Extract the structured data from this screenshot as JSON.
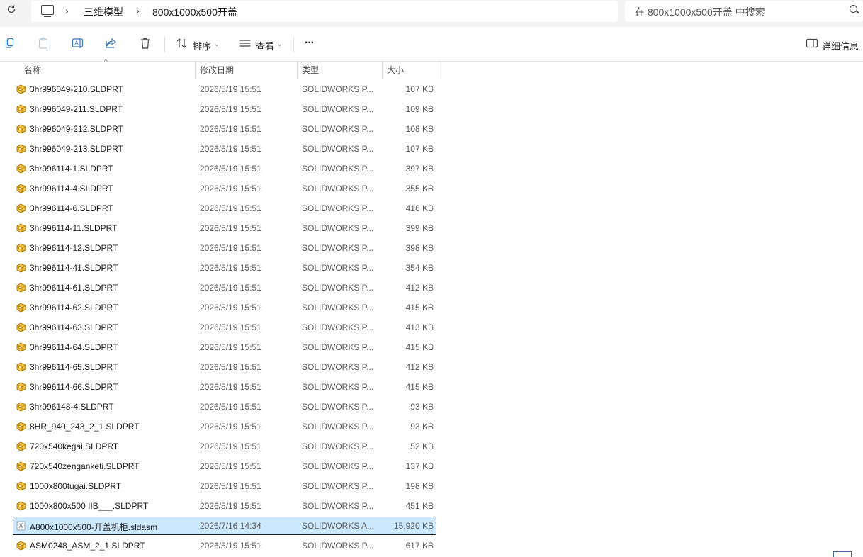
{
  "address": {
    "crumbs": [
      "三维模型",
      "800x1000x500开盖"
    ],
    "search_placeholder": "在 800x1000x500开盖 中搜索",
    "icons": [
      "refresh-icon",
      "this-pc-icon",
      "chevron-right-icon",
      "search-icon"
    ]
  },
  "toolbar": {
    "sort_label": "排序",
    "view_label": "查看",
    "more_label": "···",
    "details_label": "详细信息"
  },
  "columns": {
    "name": "名称",
    "date": "修改日期",
    "type": "类型",
    "size": "大小"
  },
  "files": [
    {
      "name": "3hr996049-210.SLDPRT",
      "date": "2026/5/19 15:51",
      "type": "SOLIDWORKS P...",
      "size": "107 KB",
      "icon": "part"
    },
    {
      "name": "3hr996049-211.SLDPRT",
      "date": "2026/5/19 15:51",
      "type": "SOLIDWORKS P...",
      "size": "109 KB",
      "icon": "part"
    },
    {
      "name": "3hr996049-212.SLDPRT",
      "date": "2026/5/19 15:51",
      "type": "SOLIDWORKS P...",
      "size": "108 KB",
      "icon": "part"
    },
    {
      "name": "3hr996049-213.SLDPRT",
      "date": "2026/5/19 15:51",
      "type": "SOLIDWORKS P...",
      "size": "107 KB",
      "icon": "part"
    },
    {
      "name": "3hr996114-1.SLDPRT",
      "date": "2026/5/19 15:51",
      "type": "SOLIDWORKS P...",
      "size": "397 KB",
      "icon": "part"
    },
    {
      "name": "3hr996114-4.SLDPRT",
      "date": "2026/5/19 15:51",
      "type": "SOLIDWORKS P...",
      "size": "355 KB",
      "icon": "part"
    },
    {
      "name": "3hr996114-6.SLDPRT",
      "date": "2026/5/19 15:51",
      "type": "SOLIDWORKS P...",
      "size": "416 KB",
      "icon": "part"
    },
    {
      "name": "3hr996114-11.SLDPRT",
      "date": "2026/5/19 15:51",
      "type": "SOLIDWORKS P...",
      "size": "399 KB",
      "icon": "part"
    },
    {
      "name": "3hr996114-12.SLDPRT",
      "date": "2026/5/19 15:51",
      "type": "SOLIDWORKS P...",
      "size": "398 KB",
      "icon": "part"
    },
    {
      "name": "3hr996114-41.SLDPRT",
      "date": "2026/5/19 15:51",
      "type": "SOLIDWORKS P...",
      "size": "354 KB",
      "icon": "part"
    },
    {
      "name": "3hr996114-61.SLDPRT",
      "date": "2026/5/19 15:51",
      "type": "SOLIDWORKS P...",
      "size": "412 KB",
      "icon": "part"
    },
    {
      "name": "3hr996114-62.SLDPRT",
      "date": "2026/5/19 15:51",
      "type": "SOLIDWORKS P...",
      "size": "415 KB",
      "icon": "part"
    },
    {
      "name": "3hr996114-63.SLDPRT",
      "date": "2026/5/19 15:51",
      "type": "SOLIDWORKS P...",
      "size": "413 KB",
      "icon": "part"
    },
    {
      "name": "3hr996114-64.SLDPRT",
      "date": "2026/5/19 15:51",
      "type": "SOLIDWORKS P...",
      "size": "415 KB",
      "icon": "part"
    },
    {
      "name": "3hr996114-65.SLDPRT",
      "date": "2026/5/19 15:51",
      "type": "SOLIDWORKS P...",
      "size": "412 KB",
      "icon": "part"
    },
    {
      "name": "3hr996114-66.SLDPRT",
      "date": "2026/5/19 15:51",
      "type": "SOLIDWORKS P...",
      "size": "415 KB",
      "icon": "part"
    },
    {
      "name": "3hr996148-4.SLDPRT",
      "date": "2026/5/19 15:51",
      "type": "SOLIDWORKS P...",
      "size": "93 KB",
      "icon": "part"
    },
    {
      "name": "8HR_940_243_2_1.SLDPRT",
      "date": "2026/5/19 15:51",
      "type": "SOLIDWORKS P...",
      "size": "93 KB",
      "icon": "part"
    },
    {
      "name": "720x540kegai.SLDPRT",
      "date": "2026/5/19 15:51",
      "type": "SOLIDWORKS P...",
      "size": "52 KB",
      "icon": "part"
    },
    {
      "name": "720x540zenganketi.SLDPRT",
      "date": "2026/5/19 15:51",
      "type": "SOLIDWORKS P...",
      "size": "137 KB",
      "icon": "part"
    },
    {
      "name": "1000x800tugai.SLDPRT",
      "date": "2026/5/19 15:51",
      "type": "SOLIDWORKS P...",
      "size": "198 KB",
      "icon": "part"
    },
    {
      "name": "1000x800x500 IIB___.SLDPRT",
      "date": "2026/5/19 15:51",
      "type": "SOLIDWORKS P...",
      "size": "451 KB",
      "icon": "part"
    },
    {
      "name": "A800x1000x500-开盖机柜.sldasm",
      "date": "2026/7/16 14:34",
      "type": "SOLIDWORKS A...",
      "size": "15,920 KB",
      "icon": "assembly",
      "selected": true
    },
    {
      "name": "ASM0248_ASM_2_1.SLDPRT",
      "date": "2026/5/19 15:51",
      "type": "SOLIDWORKS P...",
      "size": "617 KB",
      "icon": "part"
    }
  ],
  "colors": {
    "selection_bg": "#cce8ff",
    "part_icon": "#e0a21b",
    "chrome_bg": "#f3f3f3"
  }
}
